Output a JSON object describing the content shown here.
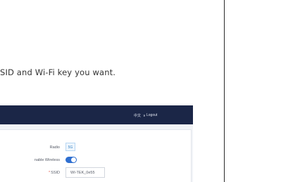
{
  "instruction": {
    "text": "SID and Wi‑Fi key you want."
  },
  "router": {
    "header": {
      "language_label": "中文",
      "language_chevron": "∨",
      "logout_label": "Logout"
    },
    "form": {
      "radio_label": "Radio",
      "radio_value": "5G",
      "enable_wireless_label": "nable Wireless",
      "enable_wireless_on": true,
      "ssid_required_mark": "*",
      "ssid_label": "SSID",
      "ssid_value": "WI-TEK_0e55"
    }
  },
  "colors": {
    "header_bg": "#1b2647",
    "toggle_on": "#2f6fd0",
    "chip_text": "#3d86c6"
  }
}
